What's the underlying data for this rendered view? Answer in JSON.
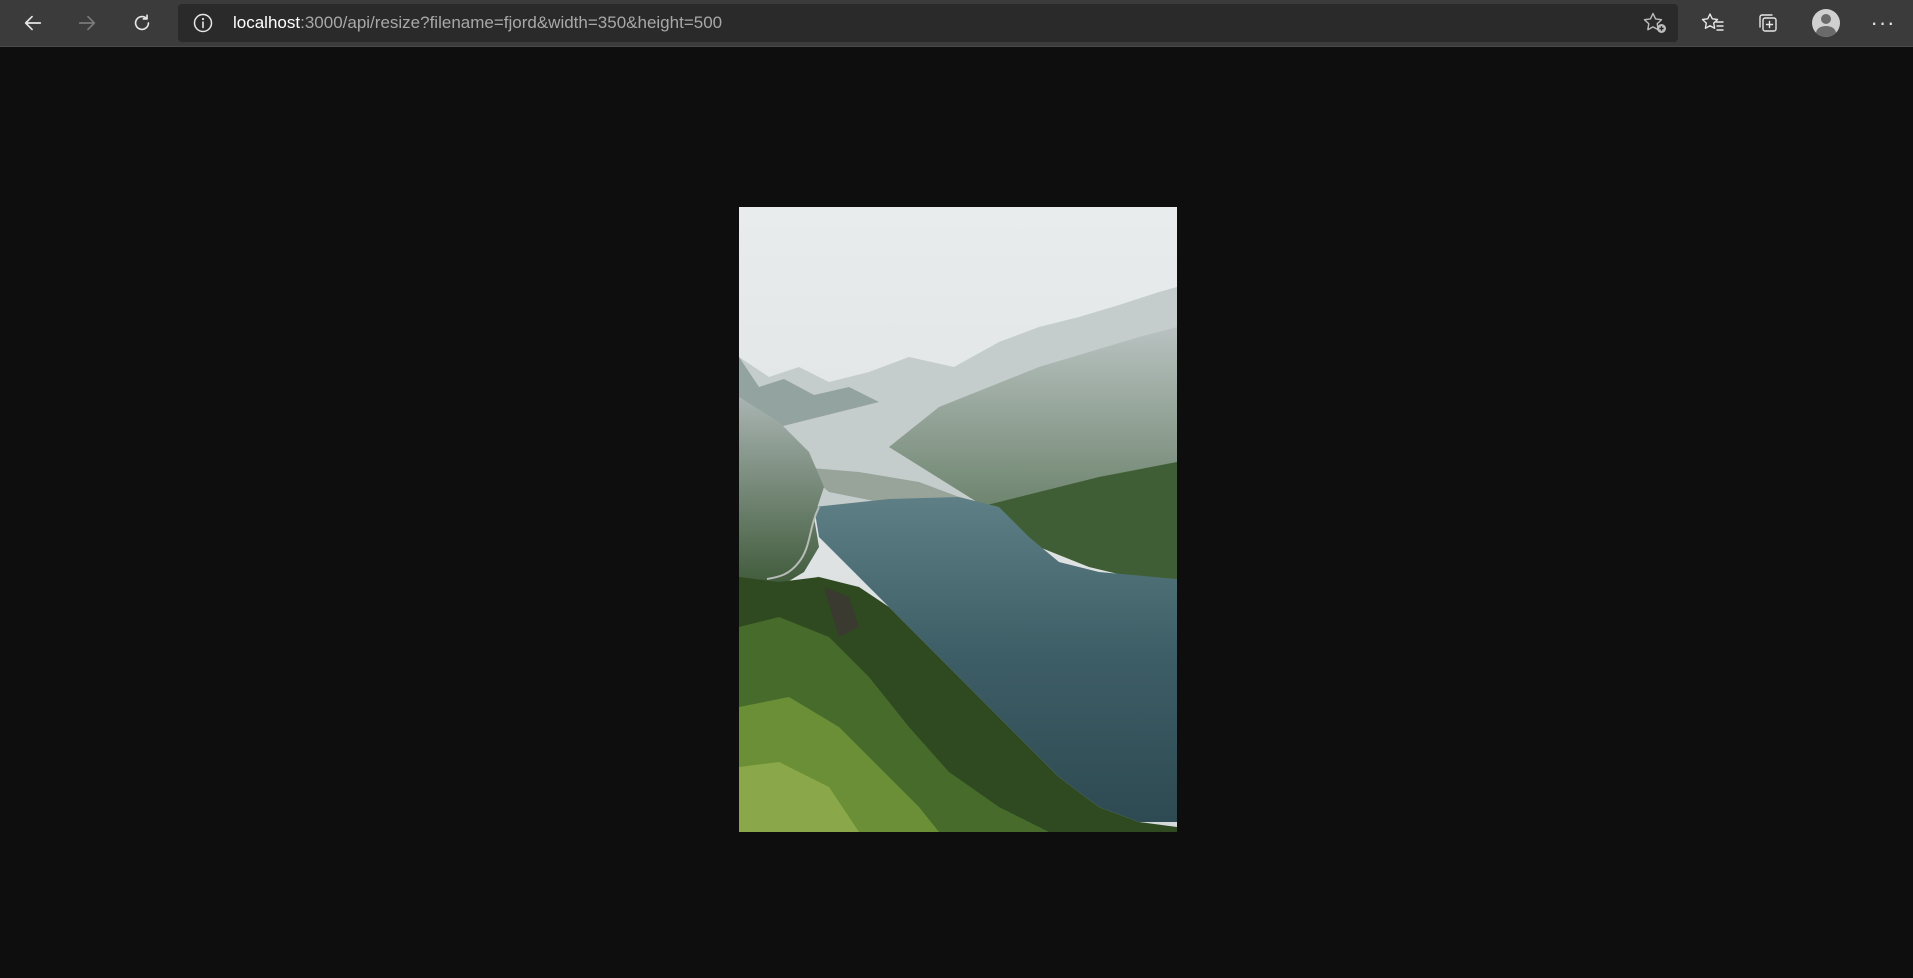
{
  "browser": {
    "url_host": "localhost",
    "url_rest": ":3000/api/resize?filename=fjord&width=350&height=500",
    "buttons": {
      "back": "arrow-left-icon",
      "forward": "arrow-right-icon",
      "refresh": "refresh-icon",
      "site_info": "info-icon",
      "add_favorite": "star-add-icon",
      "favorites": "favorites-icon",
      "collections": "collections-icon",
      "profile": "profile-avatar",
      "more": "more-icon"
    }
  },
  "page": {
    "background": "#0e0e0e",
    "image_name": "fjord"
  },
  "colors": {
    "toolbar": "#3b3b3b",
    "addressbar": "#2a2a2a",
    "url_host": "#ffffff",
    "url_path": "#a8a8a8"
  }
}
